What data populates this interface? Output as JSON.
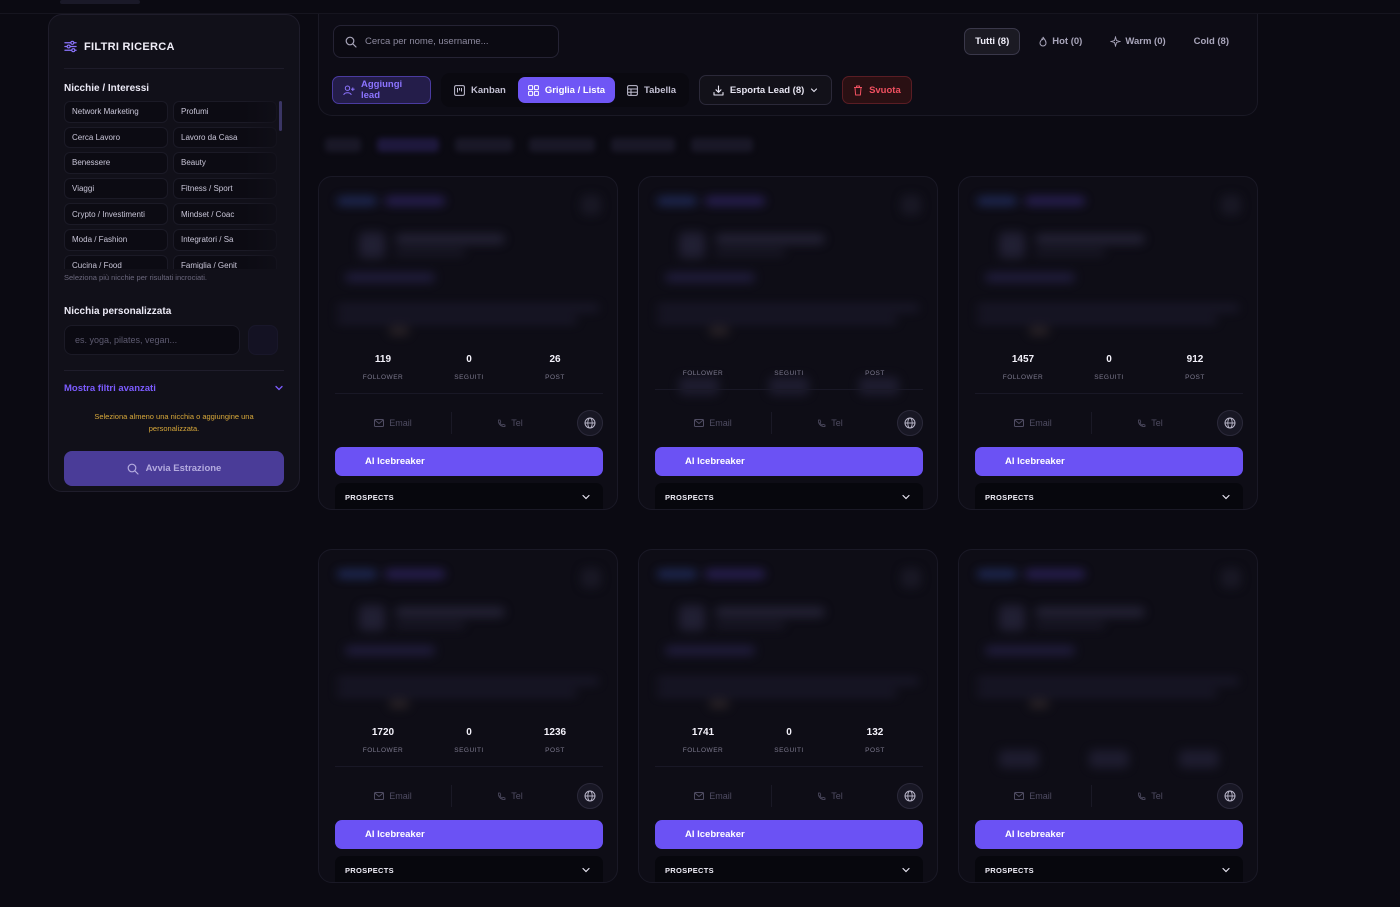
{
  "sidebar": {
    "title": "FILTRI RICERCA",
    "niches_label": "Nicchie / Interessi",
    "niches": [
      "Network Marketing",
      "Profumi",
      "Cerca Lavoro",
      "Lavoro da Casa",
      "Benessere",
      "Beauty",
      "Viaggi",
      "Fitness / Sport",
      "Crypto / Investimenti",
      "Mindset / Coac",
      "Moda / Fashion",
      "Integratori / Sa",
      "Cucina / Food",
      "Famiglia / Genit"
    ],
    "hint": "Seleziona più nicchie per risultati incrociati.",
    "custom_label": "Nicchia personalizzata",
    "custom_placeholder": "es. yoga, pilates, vegan...",
    "advanced_label": "Mostra filtri avanzati",
    "warning": "Seleziona almeno una nicchia o aggiungine una personalizzata.",
    "start_label": "Avvia Estrazione"
  },
  "toolbar": {
    "search_placeholder": "Cerca per nome, username...",
    "filters": [
      {
        "label": "Tutti (8)",
        "active": true
      },
      {
        "label": "Hot (0)",
        "icon": "flame-icon"
      },
      {
        "label": "Warm (0)",
        "icon": "sparkle-icon"
      },
      {
        "label": "Cold (8)"
      }
    ],
    "add_lead": "Aggiungi lead",
    "views": [
      "Kanban",
      "Griglia / Lista",
      "Tabella"
    ],
    "active_view": "Griglia / Lista",
    "export": "Esporta Lead (8)",
    "clear": "Svuota"
  },
  "cards": [
    {
      "follower": "119",
      "seguiti": "0",
      "post": "26",
      "stats_visible": true
    },
    {
      "follower": "",
      "seguiti": "",
      "post": "",
      "stats_visible": false,
      "stats_blurred": true
    },
    {
      "follower": "1457",
      "seguiti": "0",
      "post": "912",
      "stats_visible": true
    },
    {
      "follower": "1720",
      "seguiti": "0",
      "post": "1236",
      "stats_visible": true
    },
    {
      "follower": "1741",
      "seguiti": "0",
      "post": "132",
      "stats_visible": true
    },
    {
      "follower": "",
      "seguiti": "",
      "post": "",
      "stats_visible": false,
      "stats_blurred": true
    }
  ],
  "card_labels": {
    "follower": "FOLLOWER",
    "seguiti": "SEGUITI",
    "post": "POST",
    "email": "Email",
    "tel": "Tel",
    "ai_button": "AI Icebreaker",
    "status": "PROSPECTS"
  },
  "colors": {
    "accent": "#6b52f4",
    "background": "#0b0a12",
    "warning": "#d8a83a",
    "danger": "#f05060"
  }
}
